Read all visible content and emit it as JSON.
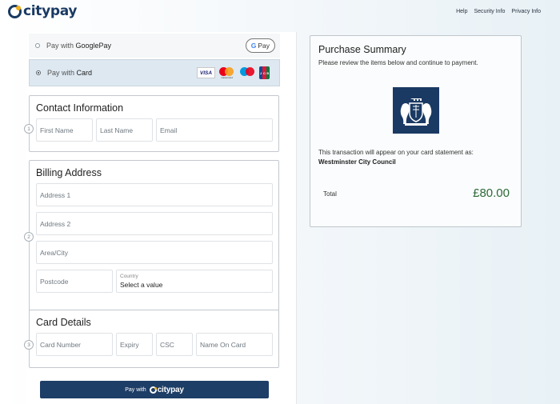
{
  "brand": {
    "name": "citypay"
  },
  "nav": {
    "links": [
      "Help",
      "Security Info",
      "Privacy Info"
    ]
  },
  "payment_methods": {
    "googlepay": {
      "label_prefix": "Pay with ",
      "label_strong": "GooglePay",
      "badge": "Pay",
      "badge_g": "G"
    },
    "card": {
      "label_prefix": "Pay with ",
      "label_strong": "Card",
      "selected": true,
      "logos": [
        "visa-icon",
        "mastercard-icon",
        "maestro-icon",
        "jcb-icon"
      ],
      "visa_text": "VISA",
      "mc_caption": "mastercard"
    }
  },
  "contact": {
    "title": "Contact Information",
    "step": "1",
    "first_name": "First Name",
    "last_name": "Last Name",
    "email": "Email"
  },
  "billing": {
    "title": "Billing Address",
    "step": "2",
    "address1": "Address 1",
    "address2": "Address 2",
    "area_city": "Area/City",
    "postcode": "Postcode",
    "country_label": "Country",
    "country_value": "Select a value"
  },
  "card_details": {
    "title": "Card Details",
    "step": "3",
    "card_number": "Card Number",
    "expiry": "Expiry",
    "csc": "CSC",
    "name_on_card": "Name On Card"
  },
  "pay_button": {
    "prefix": "Pay with",
    "brand": "citypay"
  },
  "summary": {
    "title": "Purchase Summary",
    "subtitle": "Please review the items below and continue to payment.",
    "statement_text": "This transaction will appear on your card statement as:",
    "merchant": "Westminster City Council",
    "total_label": "Total",
    "total_value": "£80.00"
  },
  "colors": {
    "brand_navy": "#1d3e66",
    "brand_gold": "#f2b21b",
    "total_green": "#2e6a37"
  }
}
